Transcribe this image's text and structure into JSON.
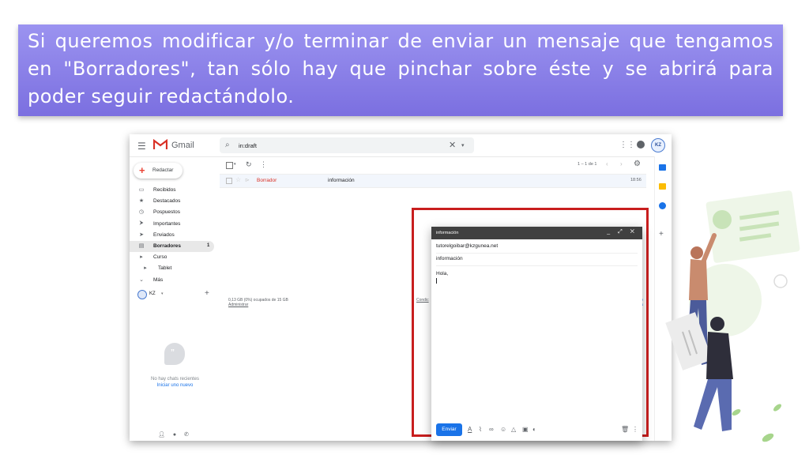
{
  "banner": {
    "text": "Si queremos modificar y/o terminar de enviar un mensaje que tengamos en \"Borradores\", tan sólo hay que pinchar sobre éste y se abrirá para poder seguir redactándolo."
  },
  "gmail": {
    "logo_text": "Gmail",
    "search_query": "in:draft",
    "account_initials": "KZ",
    "compose_label": "Redactar",
    "nav": [
      {
        "label": "Recibidos",
        "icon": "inbox-icon",
        "glyph": "▭",
        "count": ""
      },
      {
        "label": "Destacados",
        "icon": "star-icon",
        "glyph": "★",
        "count": ""
      },
      {
        "label": "Pospuestos",
        "icon": "clock-icon",
        "glyph": "◷",
        "count": ""
      },
      {
        "label": "Importantes",
        "icon": "important-icon",
        "glyph": "⮞",
        "count": ""
      },
      {
        "label": "Enviados",
        "icon": "send-icon",
        "glyph": "➤",
        "count": ""
      },
      {
        "label": "Borradores",
        "icon": "draft-icon",
        "glyph": "▤",
        "count": "1"
      },
      {
        "label": "Curso",
        "icon": "label-icon",
        "glyph": "▸",
        "count": ""
      },
      {
        "label": "Tablet",
        "icon": "label-icon",
        "glyph": "▸",
        "count": ""
      },
      {
        "label": "Más",
        "icon": "chevron-down-icon",
        "glyph": "⌄",
        "count": ""
      }
    ],
    "account_name": "KZ",
    "no_chats": "No hay chats recientes",
    "start_new": "Iniciar uno nuevo",
    "pagination": "1 – 1 de 1",
    "email_row": {
      "from": "Borrador",
      "subject": "información",
      "time": "18:56"
    },
    "storage_text": "0,13 GB (0%) ocupados de 15 GB",
    "storage_link": "Administrar",
    "conditions": "Condic",
    "side_link_1": "o",
    "side_link_2": "a"
  },
  "compose_window": {
    "title": "información",
    "to": "tutorelgoibar@kzgunea.net",
    "subject": "información",
    "body": "Hola,",
    "send_label": "Enviar"
  },
  "colors": {
    "banner": "#8a80ea",
    "highlight": "#c81e1e",
    "send_button": "#1a73e8",
    "draft_label": "#d93025"
  }
}
